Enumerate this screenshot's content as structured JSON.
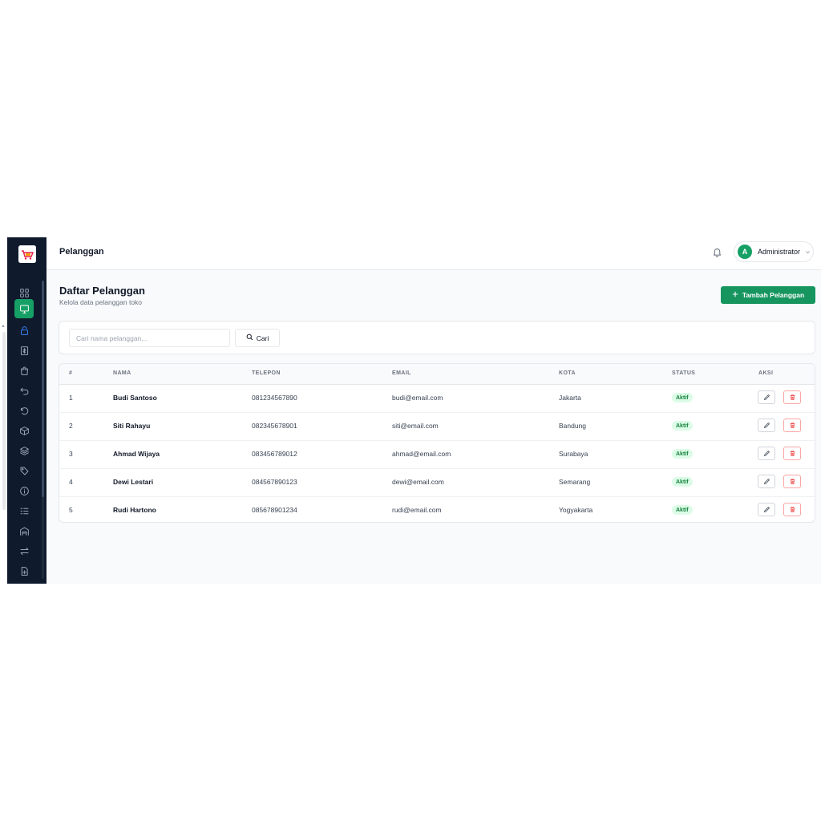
{
  "header": {
    "title": "Pelanggan"
  },
  "user": {
    "initial": "A",
    "name": "Administrator"
  },
  "page": {
    "title": "Daftar Pelanggan",
    "subtitle": "Kelola data pelanggan toko"
  },
  "actions": {
    "add_label": "Tambah Pelanggan"
  },
  "search": {
    "placeholder": "Cari nama pelanggan...",
    "value": "",
    "button_label": "Cari"
  },
  "sidebar": {
    "items": [
      {
        "icon": "grid-icon",
        "active": false
      },
      {
        "icon": "monitor-icon",
        "active": true
      },
      {
        "icon": "lock-icon",
        "active": false
      },
      {
        "icon": "receipt-icon",
        "active": false
      },
      {
        "icon": "shopping-bag-icon",
        "active": false
      },
      {
        "icon": "undo-icon",
        "active": false
      },
      {
        "icon": "rotate-ccw-icon",
        "active": false
      },
      {
        "icon": "box-icon",
        "active": false
      },
      {
        "icon": "layers-icon",
        "active": false
      },
      {
        "icon": "tag-icon",
        "active": false
      },
      {
        "icon": "info-icon",
        "active": false
      },
      {
        "icon": "list-icon",
        "active": false
      },
      {
        "icon": "warehouse-icon",
        "active": false
      },
      {
        "icon": "transfer-icon",
        "active": false
      },
      {
        "icon": "file-plus-icon",
        "active": false
      }
    ]
  },
  "table": {
    "columns": [
      "#",
      "NAMA",
      "TELEPON",
      "EMAIL",
      "KOTA",
      "STATUS",
      "AKSI"
    ],
    "rows": [
      {
        "no": "1",
        "nama": "Budi Santoso",
        "telepon": "081234567890",
        "email": "budi@email.com",
        "kota": "Jakarta",
        "status": "Aktif"
      },
      {
        "no": "2",
        "nama": "Siti Rahayu",
        "telepon": "082345678901",
        "email": "siti@email.com",
        "kota": "Bandung",
        "status": "Aktif"
      },
      {
        "no": "3",
        "nama": "Ahmad Wijaya",
        "telepon": "083456789012",
        "email": "ahmad@email.com",
        "kota": "Surabaya",
        "status": "Aktif"
      },
      {
        "no": "4",
        "nama": "Dewi Lestari",
        "telepon": "084567890123",
        "email": "dewi@email.com",
        "kota": "Semarang",
        "status": "Aktif"
      },
      {
        "no": "5",
        "nama": "Rudi Hartono",
        "telepon": "085678901234",
        "email": "rudi@email.com",
        "kota": "Yogyakarta",
        "status": "Aktif"
      }
    ]
  },
  "colors": {
    "primary": "#16955f",
    "sidebar_bg": "#0f1b2d",
    "active_nav": "#16a065",
    "badge_bg": "#dcfce7",
    "badge_text": "#15803d",
    "danger": "#ef4444"
  }
}
